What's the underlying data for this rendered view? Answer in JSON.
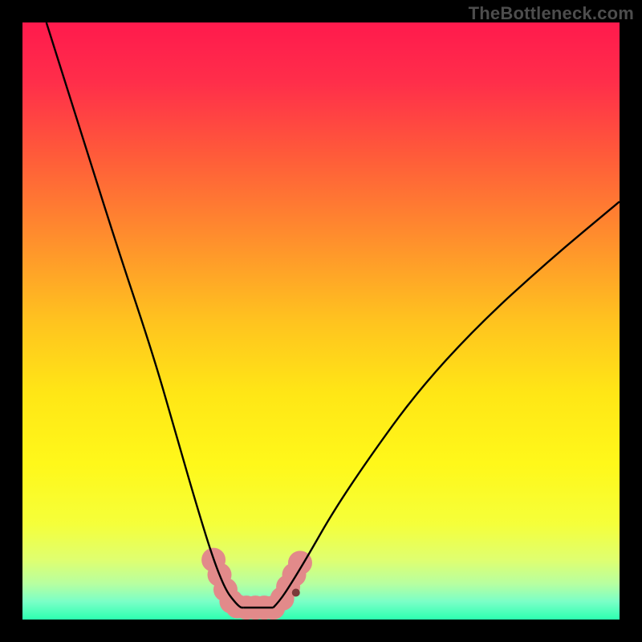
{
  "watermark": "TheBottleneck.com",
  "gradient_stops": [
    {
      "offset": 0.0,
      "color": "#ff1a4d"
    },
    {
      "offset": 0.1,
      "color": "#ff2e4a"
    },
    {
      "offset": 0.22,
      "color": "#ff5a3a"
    },
    {
      "offset": 0.35,
      "color": "#ff8a2e"
    },
    {
      "offset": 0.5,
      "color": "#ffc31f"
    },
    {
      "offset": 0.62,
      "color": "#ffe616"
    },
    {
      "offset": 0.74,
      "color": "#fff81a"
    },
    {
      "offset": 0.84,
      "color": "#f5ff3a"
    },
    {
      "offset": 0.9,
      "color": "#dfff70"
    },
    {
      "offset": 0.94,
      "color": "#b7ffa0"
    },
    {
      "offset": 0.97,
      "color": "#7affc7"
    },
    {
      "offset": 1.0,
      "color": "#2cffb0"
    }
  ],
  "chart_data": {
    "type": "line",
    "title": "",
    "xlabel": "",
    "ylabel": "",
    "xlim": [
      0,
      100
    ],
    "ylim": [
      0,
      100
    ],
    "grid": false,
    "series": [
      {
        "name": "left-branch",
        "x": [
          4,
          10,
          16,
          22,
          26,
          29.5,
          32,
          34,
          35.5,
          36.5,
          37
        ],
        "y": [
          100,
          81,
          62,
          44,
          30,
          18,
          10,
          5,
          3,
          2,
          2
        ]
      },
      {
        "name": "right-branch",
        "x": [
          42,
          43,
          45,
          48,
          52,
          58,
          66,
          76,
          88,
          100
        ],
        "y": [
          2,
          3,
          6,
          11,
          18,
          27,
          38,
          49,
          60,
          70
        ]
      },
      {
        "name": "valley-floor",
        "x": [
          37,
          42
        ],
        "y": [
          2,
          2
        ]
      }
    ],
    "highlight_points": {
      "color": "#e28a8a",
      "radius": 15,
      "points": [
        {
          "x": 32.0,
          "y": 10.0
        },
        {
          "x": 33.0,
          "y": 7.5
        },
        {
          "x": 34.0,
          "y": 5.0
        },
        {
          "x": 35.0,
          "y": 3.0
        },
        {
          "x": 36.0,
          "y": 2.2
        },
        {
          "x": 37.5,
          "y": 2.0
        },
        {
          "x": 39.0,
          "y": 2.0
        },
        {
          "x": 40.5,
          "y": 2.0
        },
        {
          "x": 42.0,
          "y": 2.0
        },
        {
          "x": 43.5,
          "y": 3.5
        },
        {
          "x": 44.5,
          "y": 5.5
        },
        {
          "x": 45.5,
          "y": 7.5
        },
        {
          "x": 46.5,
          "y": 9.5
        }
      ]
    },
    "extra_dot": {
      "x": 45.8,
      "y": 4.5,
      "color": "#7a3a3a",
      "radius": 5
    }
  }
}
